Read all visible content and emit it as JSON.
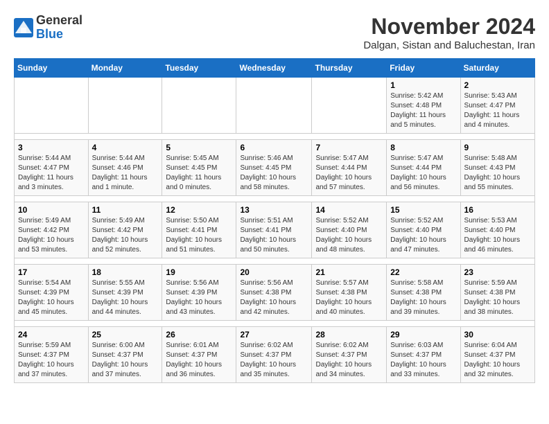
{
  "logo": {
    "general": "General",
    "blue": "Blue"
  },
  "title": "November 2024",
  "subtitle": "Dalgan, Sistan and Baluchestan, Iran",
  "weekdays": [
    "Sunday",
    "Monday",
    "Tuesday",
    "Wednesday",
    "Thursday",
    "Friday",
    "Saturday"
  ],
  "weeks": [
    [
      {
        "day": "",
        "info": ""
      },
      {
        "day": "",
        "info": ""
      },
      {
        "day": "",
        "info": ""
      },
      {
        "day": "",
        "info": ""
      },
      {
        "day": "",
        "info": ""
      },
      {
        "day": "1",
        "info": "Sunrise: 5:42 AM\nSunset: 4:48 PM\nDaylight: 11 hours\nand 5 minutes."
      },
      {
        "day": "2",
        "info": "Sunrise: 5:43 AM\nSunset: 4:47 PM\nDaylight: 11 hours\nand 4 minutes."
      }
    ],
    [
      {
        "day": "3",
        "info": "Sunrise: 5:44 AM\nSunset: 4:47 PM\nDaylight: 11 hours\nand 3 minutes."
      },
      {
        "day": "4",
        "info": "Sunrise: 5:44 AM\nSunset: 4:46 PM\nDaylight: 11 hours\nand 1 minute."
      },
      {
        "day": "5",
        "info": "Sunrise: 5:45 AM\nSunset: 4:45 PM\nDaylight: 11 hours\nand 0 minutes."
      },
      {
        "day": "6",
        "info": "Sunrise: 5:46 AM\nSunset: 4:45 PM\nDaylight: 10 hours\nand 58 minutes."
      },
      {
        "day": "7",
        "info": "Sunrise: 5:47 AM\nSunset: 4:44 PM\nDaylight: 10 hours\nand 57 minutes."
      },
      {
        "day": "8",
        "info": "Sunrise: 5:47 AM\nSunset: 4:44 PM\nDaylight: 10 hours\nand 56 minutes."
      },
      {
        "day": "9",
        "info": "Sunrise: 5:48 AM\nSunset: 4:43 PM\nDaylight: 10 hours\nand 55 minutes."
      }
    ],
    [
      {
        "day": "10",
        "info": "Sunrise: 5:49 AM\nSunset: 4:42 PM\nDaylight: 10 hours\nand 53 minutes."
      },
      {
        "day": "11",
        "info": "Sunrise: 5:49 AM\nSunset: 4:42 PM\nDaylight: 10 hours\nand 52 minutes."
      },
      {
        "day": "12",
        "info": "Sunrise: 5:50 AM\nSunset: 4:41 PM\nDaylight: 10 hours\nand 51 minutes."
      },
      {
        "day": "13",
        "info": "Sunrise: 5:51 AM\nSunset: 4:41 PM\nDaylight: 10 hours\nand 50 minutes."
      },
      {
        "day": "14",
        "info": "Sunrise: 5:52 AM\nSunset: 4:40 PM\nDaylight: 10 hours\nand 48 minutes."
      },
      {
        "day": "15",
        "info": "Sunrise: 5:52 AM\nSunset: 4:40 PM\nDaylight: 10 hours\nand 47 minutes."
      },
      {
        "day": "16",
        "info": "Sunrise: 5:53 AM\nSunset: 4:40 PM\nDaylight: 10 hours\nand 46 minutes."
      }
    ],
    [
      {
        "day": "17",
        "info": "Sunrise: 5:54 AM\nSunset: 4:39 PM\nDaylight: 10 hours\nand 45 minutes."
      },
      {
        "day": "18",
        "info": "Sunrise: 5:55 AM\nSunset: 4:39 PM\nDaylight: 10 hours\nand 44 minutes."
      },
      {
        "day": "19",
        "info": "Sunrise: 5:56 AM\nSunset: 4:39 PM\nDaylight: 10 hours\nand 43 minutes."
      },
      {
        "day": "20",
        "info": "Sunrise: 5:56 AM\nSunset: 4:38 PM\nDaylight: 10 hours\nand 42 minutes."
      },
      {
        "day": "21",
        "info": "Sunrise: 5:57 AM\nSunset: 4:38 PM\nDaylight: 10 hours\nand 40 minutes."
      },
      {
        "day": "22",
        "info": "Sunrise: 5:58 AM\nSunset: 4:38 PM\nDaylight: 10 hours\nand 39 minutes."
      },
      {
        "day": "23",
        "info": "Sunrise: 5:59 AM\nSunset: 4:38 PM\nDaylight: 10 hours\nand 38 minutes."
      }
    ],
    [
      {
        "day": "24",
        "info": "Sunrise: 5:59 AM\nSunset: 4:37 PM\nDaylight: 10 hours\nand 37 minutes."
      },
      {
        "day": "25",
        "info": "Sunrise: 6:00 AM\nSunset: 4:37 PM\nDaylight: 10 hours\nand 37 minutes."
      },
      {
        "day": "26",
        "info": "Sunrise: 6:01 AM\nSunset: 4:37 PM\nDaylight: 10 hours\nand 36 minutes."
      },
      {
        "day": "27",
        "info": "Sunrise: 6:02 AM\nSunset: 4:37 PM\nDaylight: 10 hours\nand 35 minutes."
      },
      {
        "day": "28",
        "info": "Sunrise: 6:02 AM\nSunset: 4:37 PM\nDaylight: 10 hours\nand 34 minutes."
      },
      {
        "day": "29",
        "info": "Sunrise: 6:03 AM\nSunset: 4:37 PM\nDaylight: 10 hours\nand 33 minutes."
      },
      {
        "day": "30",
        "info": "Sunrise: 6:04 AM\nSunset: 4:37 PM\nDaylight: 10 hours\nand 32 minutes."
      }
    ]
  ]
}
